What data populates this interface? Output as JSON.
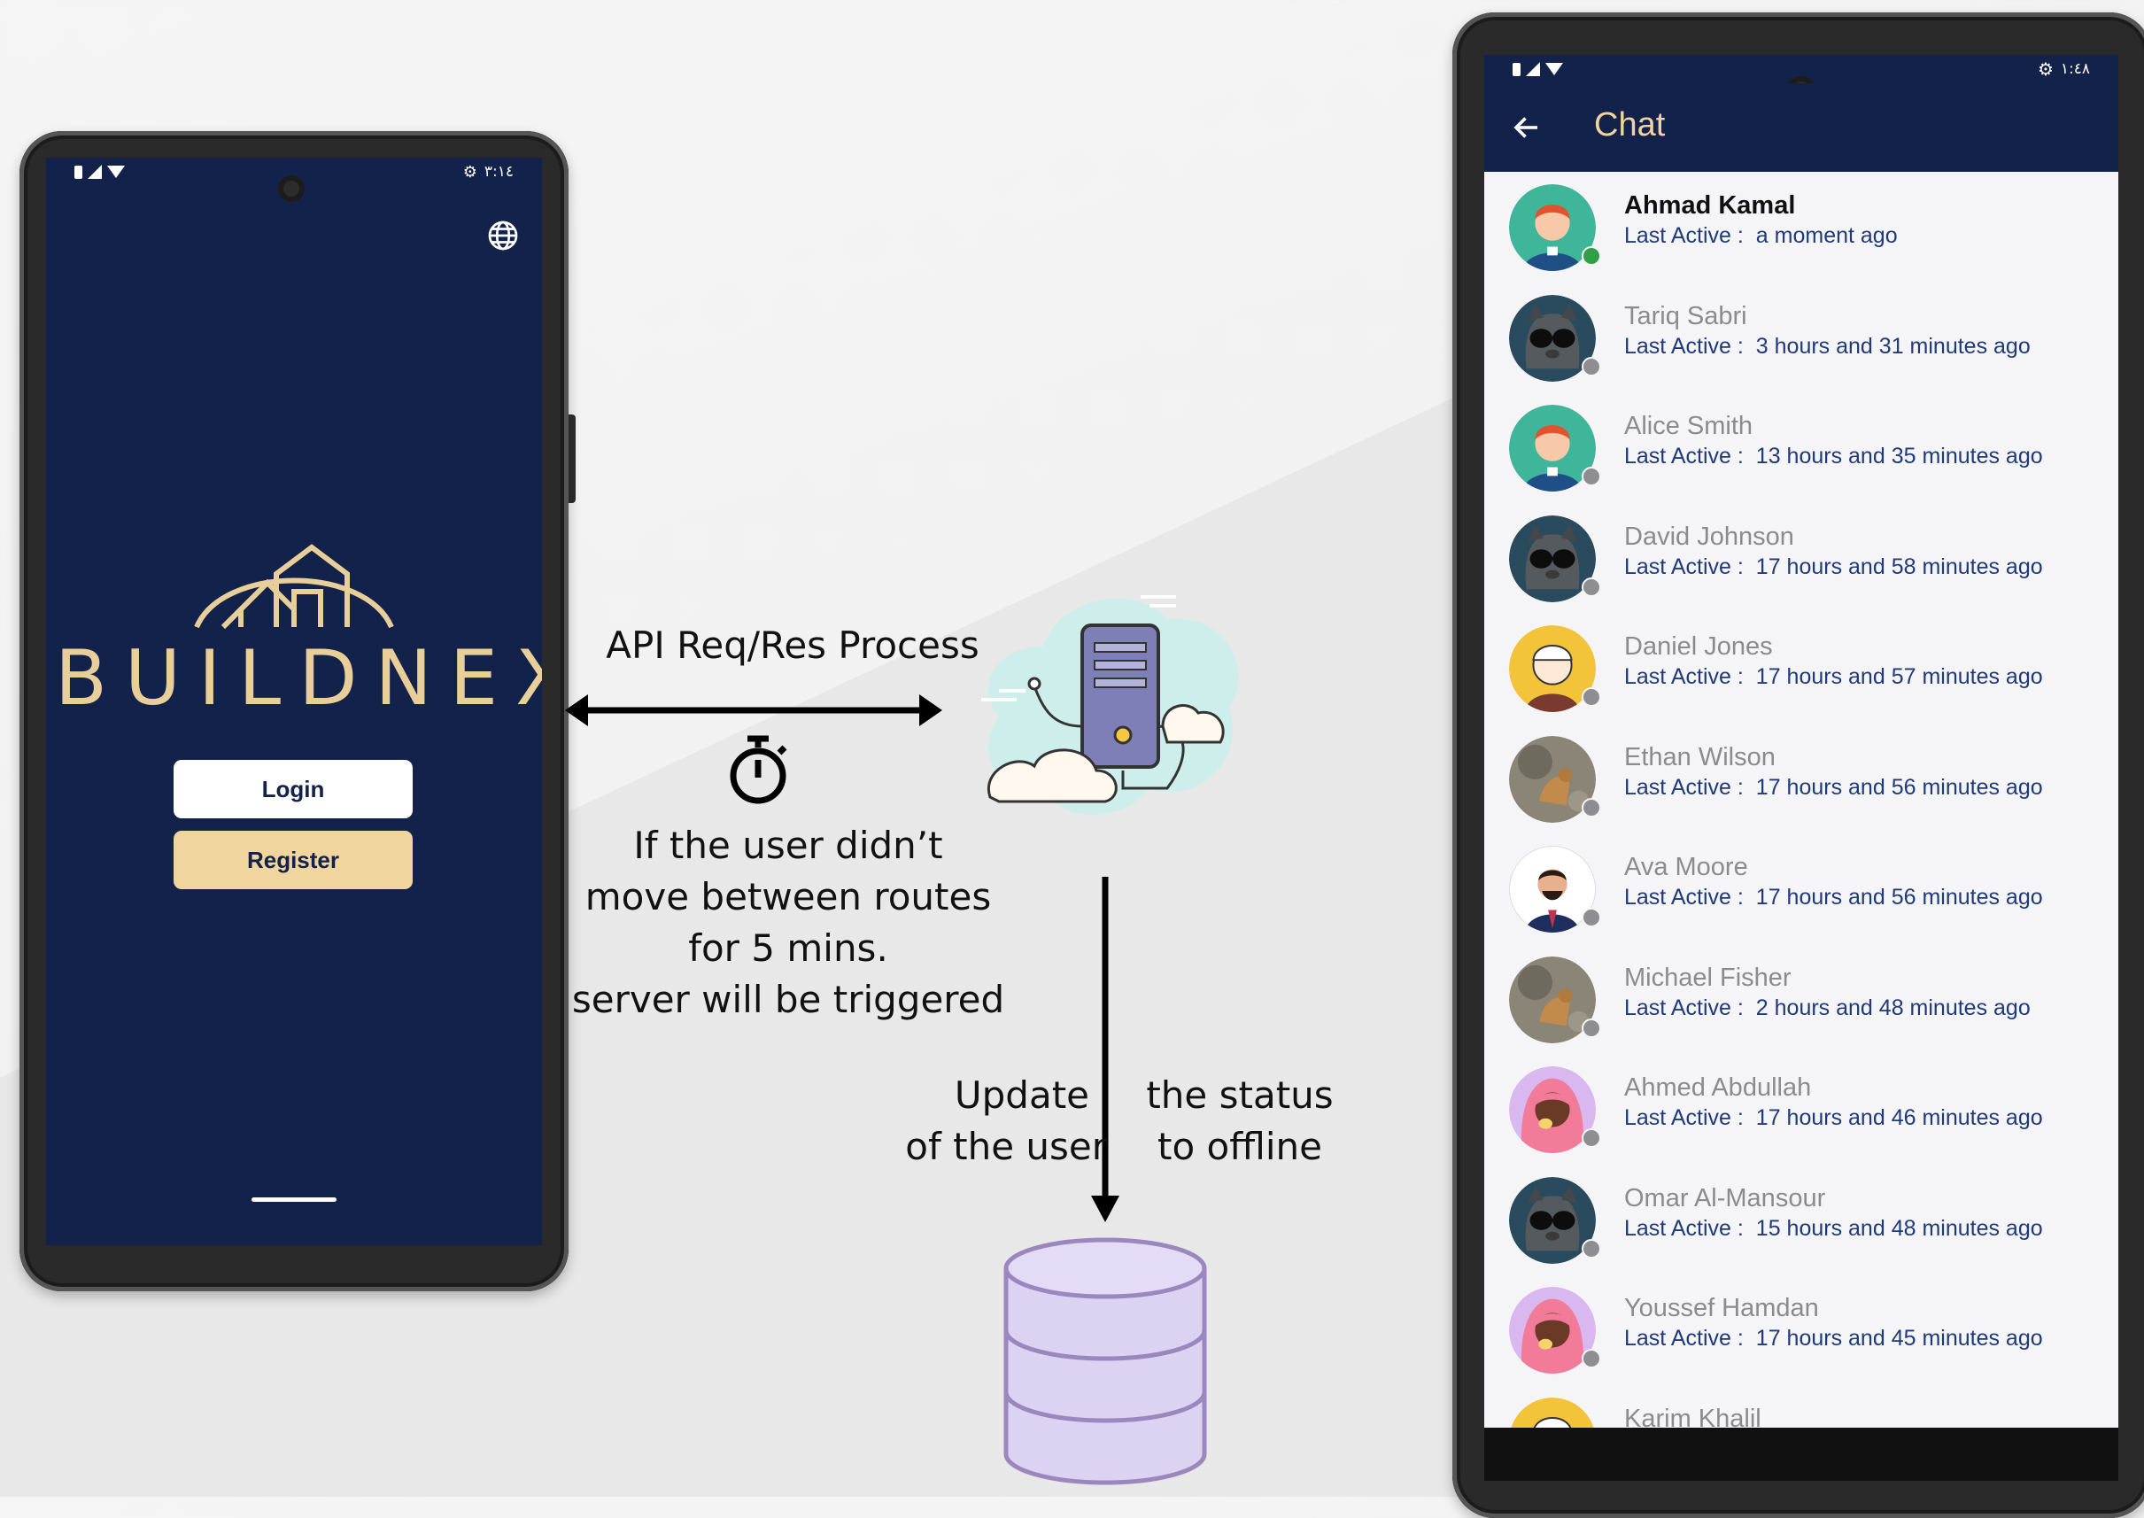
{
  "left_phone": {
    "status_time": "٣:١٤",
    "brand": "BUILDNEX",
    "login_label": "Login",
    "register_label": "Register"
  },
  "diagram": {
    "api_label": "API Req/Res Process",
    "timer_note": [
      "If the user didn’t",
      "move between routes",
      "for 5 mins.",
      "server will be triggered"
    ],
    "update_left": [
      "Update",
      "of the user"
    ],
    "update_right": [
      "the status",
      "to offline"
    ]
  },
  "right_phone": {
    "status_time": "١:٤٨",
    "title": "Chat",
    "last_active_label": "Last Active :",
    "contacts": [
      {
        "name": "Ahmad Kamal",
        "last_active": "a moment ago",
        "online": true,
        "avatar": "boy-teal"
      },
      {
        "name": "Tariq Sabri",
        "last_active": "3 hours and 31 minutes ago",
        "online": false,
        "avatar": "cat-sunglasses"
      },
      {
        "name": "Alice Smith",
        "last_active": "13 hours and 35 minutes ago",
        "online": false,
        "avatar": "boy-teal"
      },
      {
        "name": "David Johnson",
        "last_active": "17 hours and 58 minutes ago",
        "online": false,
        "avatar": "cat-sunglasses"
      },
      {
        "name": "Daniel Jones",
        "last_active": "17 hours and 57 minutes ago",
        "online": false,
        "avatar": "boy-yellow"
      },
      {
        "name": "Ethan Wilson",
        "last_active": "17 hours and 56 minutes ago",
        "online": false,
        "avatar": "photo-dog"
      },
      {
        "name": "Ava Moore",
        "last_active": "17 hours and 56 minutes ago",
        "online": false,
        "avatar": "man-suit"
      },
      {
        "name": "Michael Fisher",
        "last_active": "2 hours and 48 minutes ago",
        "online": false,
        "avatar": "photo-dog"
      },
      {
        "name": "Ahmed Abdullah",
        "last_active": "17 hours and 46 minutes ago",
        "online": false,
        "avatar": "woman-pink"
      },
      {
        "name": "Omar Al-Mansour",
        "last_active": "15 hours and 48 minutes ago",
        "online": false,
        "avatar": "cat-sunglasses"
      },
      {
        "name": "Youssef Hamdan",
        "last_active": "17 hours and 45 minutes ago",
        "online": false,
        "avatar": "woman-pink"
      },
      {
        "name": "Karim Khalil",
        "last_active": "",
        "online": false,
        "avatar": "boy-yellow"
      }
    ]
  },
  "colors": {
    "navy": "#13224b",
    "gold": "#e8cf9a",
    "button_gold": "#f1d59f",
    "online": "#2e9e47",
    "offline": "#8e8e92",
    "db_fill": "#dcd3f2",
    "db_stroke": "#9a87be"
  }
}
